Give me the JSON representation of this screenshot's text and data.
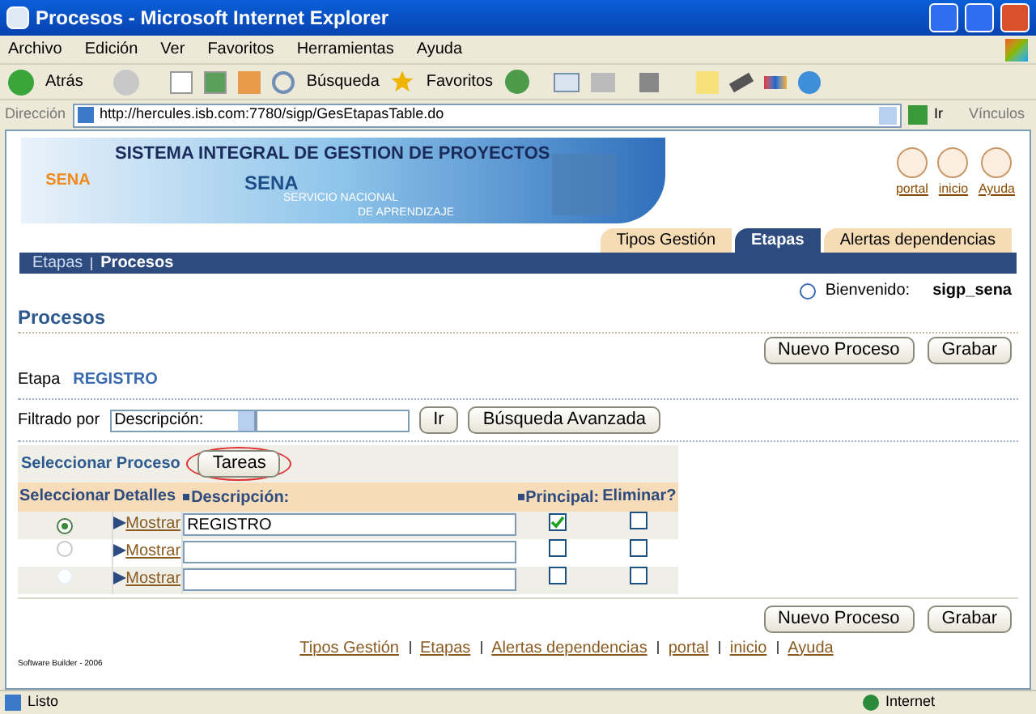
{
  "window": {
    "title": "Procesos - Microsoft Internet Explorer"
  },
  "menu": [
    "Archivo",
    "Edición",
    "Ver",
    "Favoritos",
    "Herramientas",
    "Ayuda"
  ],
  "toolbar": {
    "back": "Atrás",
    "search": "Búsqueda",
    "favorites": "Favoritos"
  },
  "address": {
    "label": "Dirección",
    "url": "http://hercules.isb.com:7780/sigp/GesEtapasTable.do",
    "go": "Ir",
    "links": "Vínculos"
  },
  "banner": {
    "title": "SISTEMA INTEGRAL DE GESTION DE PROYECTOS",
    "logo": "SENA",
    "brand": "SENA",
    "subtitle_1": "SERVICIO NACIONAL",
    "subtitle_2": "DE APRENDIZAJE"
  },
  "header_links": [
    "portal",
    "inicio",
    "Ayuda"
  ],
  "tabs": [
    {
      "label": "Tipos Gestión",
      "selected": false
    },
    {
      "label": "Etapas",
      "selected": true
    },
    {
      "label": "Alertas dependencias",
      "selected": false
    }
  ],
  "breadcrumb": [
    {
      "label": "Etapas",
      "selected": false
    },
    {
      "label": "Procesos",
      "selected": true
    }
  ],
  "welcome": {
    "label": "Bienvenido:",
    "user": "sigp_sena"
  },
  "page_title": "Procesos",
  "buttons": [
    "Nuevo Proceso",
    "Grabar"
  ],
  "etapa": {
    "label": "Etapa",
    "value": "REGISTRO"
  },
  "filter": {
    "label": "Filtrado por",
    "select": "Descripción:",
    "go": "Ir",
    "advanced": "Búsqueda Avanzada"
  },
  "table": {
    "title": "Seleccionar Proceso",
    "action": "Tareas",
    "columns": [
      {
        "label": "Seleccionar",
        "required": false
      },
      {
        "label": "Detalles",
        "required": false
      },
      {
        "label": "Descripción:",
        "required": true
      },
      {
        "label": "Principal:",
        "required": true
      },
      {
        "label": "Eliminar?",
        "required": false
      }
    ],
    "rows": [
      {
        "selected": true,
        "disabled": false,
        "details": "Mostrar",
        "description": "REGISTRO",
        "principal": true,
        "eliminar": false
      },
      {
        "selected": false,
        "disabled": false,
        "details": "Mostrar",
        "principal": false,
        "eliminar": false
      },
      {
        "selected": false,
        "disabled": true,
        "details": "Mostrar",
        "principal": false,
        "eliminar": false
      }
    ]
  },
  "bottom_buttons": [
    "Nuevo Proceso",
    "Grabar"
  ],
  "footer_links": [
    "Tipos Gestión",
    "Etapas",
    "Alertas dependencias",
    "portal",
    "inicio",
    "Ayuda"
  ],
  "copyright": "Software Builder - 2006",
  "status_bar": {
    "text": "Listo",
    "zone": "Internet"
  }
}
